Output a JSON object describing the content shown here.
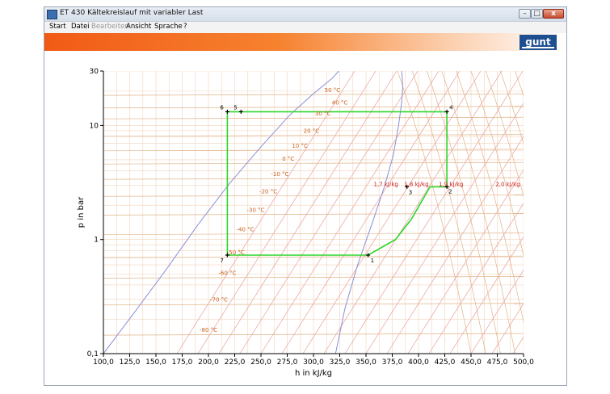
{
  "window": {
    "title": "ET 430 Kältekreislauf mit variabler Last",
    "minimize_glyph": "–",
    "maximize_glyph": "□",
    "close_glyph": "x"
  },
  "menu": [
    {
      "label": "Start",
      "enabled": true
    },
    {
      "label": "Datei",
      "enabled": true
    },
    {
      "label": "Bearbeiten",
      "enabled": false
    },
    {
      "label": "Ansicht",
      "enabled": true
    },
    {
      "label": "Sprache",
      "enabled": true
    },
    {
      "label": "?",
      "enabled": true
    }
  ],
  "logo": {
    "text": "gunt"
  },
  "colors": {
    "banner_start": "#f15a16",
    "cycle": "#2bd62b",
    "isotherm": "#e0b48a",
    "grid": "#f1d3bc",
    "saturation": "#8a8fd8",
    "quality": "#e8a09a"
  },
  "chart_data": {
    "type": "line",
    "xlabel": "h in kJ/kg",
    "ylabel": "p in bar",
    "xlim": [
      100,
      500
    ],
    "ylim": [
      0.1,
      30
    ],
    "yscale": "log",
    "x_tick_labels": [
      "100,0",
      "125,0",
      "150,0",
      "175,0",
      "200,0",
      "225,0",
      "250,0",
      "275,0",
      "300,0",
      "325,0",
      "350,0",
      "375,0",
      "400,0",
      "425,0",
      "450,0",
      "475,0",
      "500,0"
    ],
    "x_ticks": [
      100,
      125,
      150,
      175,
      200,
      225,
      250,
      275,
      300,
      325,
      350,
      375,
      400,
      425,
      450,
      475,
      500
    ],
    "y_ticks": [
      {
        "value": 0.1,
        "label": "0,1"
      },
      {
        "value": 1,
        "label": "1"
      },
      {
        "value": 10,
        "label": "10"
      },
      {
        "value": 30,
        "label": "30"
      }
    ],
    "isotherm_labels": [
      {
        "label": "50 °C",
        "h": 318,
        "p": 19.6
      },
      {
        "label": "40 °C",
        "h": 325,
        "p": 15.2
      },
      {
        "label": "30 °C",
        "h": 309,
        "p": 12.2
      },
      {
        "label": "20 °C",
        "h": 298,
        "p": 8.6
      },
      {
        "label": "10 °C",
        "h": 287,
        "p": 6.4
      },
      {
        "label": "0 °C",
        "h": 276,
        "p": 4.9
      },
      {
        "label": "-10 °C",
        "h": 268,
        "p": 3.6
      },
      {
        "label": "-20 °C",
        "h": 257,
        "p": 2.55
      },
      {
        "label": "-30 °C",
        "h": 245,
        "p": 1.75
      },
      {
        "label": "-40 °C",
        "h": 235,
        "p": 1.18
      },
      {
        "label": "-50 °C",
        "h": 226,
        "p": 0.74
      },
      {
        "label": "-60 °C",
        "h": 218,
        "p": 0.49
      },
      {
        "label": "-70 °C",
        "h": 210,
        "p": 0.285
      },
      {
        "label": "-80 °C",
        "h": 200,
        "p": 0.155
      }
    ],
    "quality_labels": [
      {
        "label": "1,7 kJ/kg",
        "h": 369,
        "p": 2.95
      },
      {
        "label": "1,8 kJ/kg",
        "h": 398,
        "p": 2.95
      },
      {
        "label": "1,9 kJ/kg",
        "h": 431,
        "p": 2.95
      },
      {
        "label": "2,0 kJ/kg",
        "h": 485,
        "p": 2.95
      }
    ],
    "cycle_points": [
      {
        "id": "1",
        "h": 352,
        "p": 0.73
      },
      {
        "id": "2",
        "h": 427,
        "p": 2.9
      },
      {
        "id": "3",
        "h": 389,
        "p": 2.9
      },
      {
        "id": "4",
        "h": 427,
        "p": 13.2
      },
      {
        "id": "5",
        "h": 231,
        "p": 13.2
      },
      {
        "id": "6",
        "h": 218,
        "p": 13.2
      },
      {
        "id": "7",
        "h": 218,
        "p": 0.73
      }
    ],
    "series": [
      {
        "points": [
          [
            218,
            0.73
          ],
          [
            218,
            13.2
          ],
          [
            427,
            13.2
          ],
          [
            427,
            2.9
          ],
          [
            411,
            2.9
          ],
          [
            393,
            1.5
          ],
          [
            378,
            1.0
          ],
          [
            352,
            0.73
          ],
          [
            218,
            0.73
          ]
        ]
      }
    ]
  }
}
